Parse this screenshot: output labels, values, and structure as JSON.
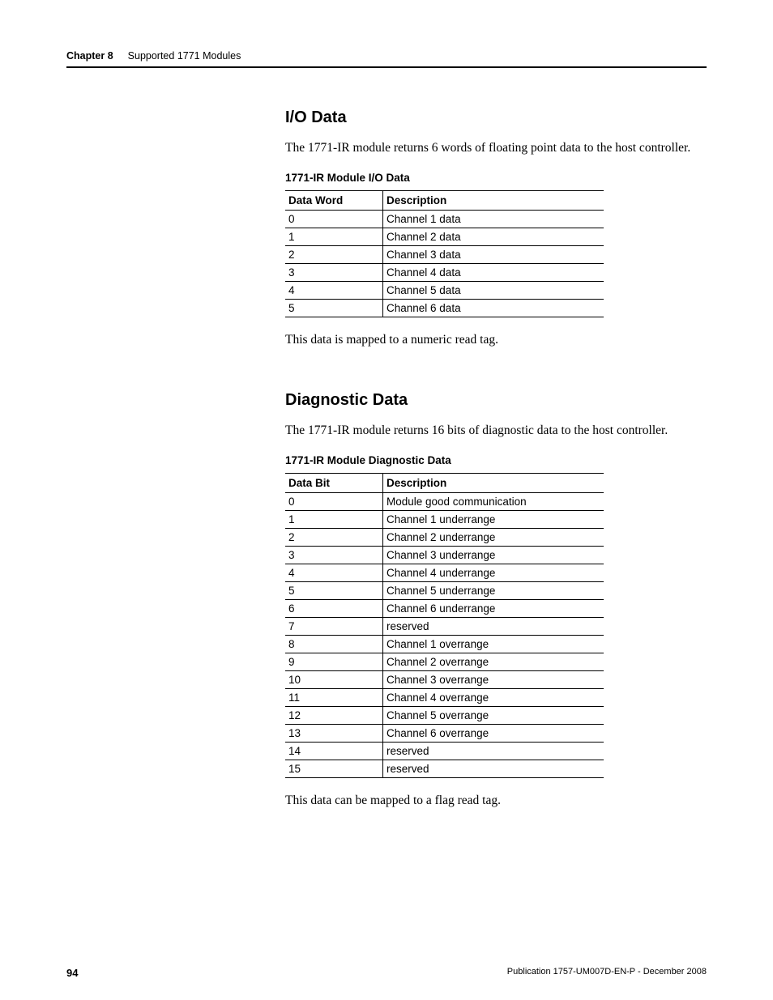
{
  "header": {
    "chapter": "Chapter 8",
    "title": "Supported 1771 Modules"
  },
  "section1": {
    "heading": "I/O Data",
    "intro": "The 1771-IR module returns 6 words of floating point data to the host controller.",
    "tableCaption": "1771-IR Module I/O Data",
    "th1": "Data Word",
    "th2": "Description",
    "rows": [
      {
        "c1": "0",
        "c2": "Channel 1 data"
      },
      {
        "c1": "1",
        "c2": "Channel 2 data"
      },
      {
        "c1": "2",
        "c2": "Channel 3 data"
      },
      {
        "c1": "3",
        "c2": "Channel 4 data"
      },
      {
        "c1": "4",
        "c2": "Channel 5 data"
      },
      {
        "c1": "5",
        "c2": "Channel 6 data"
      }
    ],
    "outro": "This data is mapped to a numeric read tag."
  },
  "section2": {
    "heading": "Diagnostic Data",
    "intro": "The 1771-IR module returns 16 bits of diagnostic data to the host controller.",
    "tableCaption": "1771-IR Module Diagnostic Data",
    "th1": "Data Bit",
    "th2": "Description",
    "rows": [
      {
        "c1": "0",
        "c2": "Module good communication"
      },
      {
        "c1": "1",
        "c2": "Channel 1 underrange"
      },
      {
        "c1": "2",
        "c2": "Channel 2 underrange"
      },
      {
        "c1": "3",
        "c2": "Channel 3 underrange"
      },
      {
        "c1": "4",
        "c2": "Channel 4 underrange"
      },
      {
        "c1": "5",
        "c2": "Channel 5 underrange"
      },
      {
        "c1": "6",
        "c2": "Channel 6 underrange"
      },
      {
        "c1": "7",
        "c2": "reserved"
      },
      {
        "c1": "8",
        "c2": "Channel 1 overrange"
      },
      {
        "c1": "9",
        "c2": "Channel 2 overrange"
      },
      {
        "c1": "10",
        "c2": "Channel 3 overrange"
      },
      {
        "c1": "11",
        "c2": "Channel 4 overrange"
      },
      {
        "c1": "12",
        "c2": "Channel 5 overrange"
      },
      {
        "c1": "13",
        "c2": "Channel 6 overrange"
      },
      {
        "c1": "14",
        "c2": "reserved"
      },
      {
        "c1": "15",
        "c2": "reserved"
      }
    ],
    "outro": "This data can be mapped to a flag read tag."
  },
  "footer": {
    "page": "94",
    "publication": "Publication 1757-UM007D-EN-P - December 2008"
  }
}
